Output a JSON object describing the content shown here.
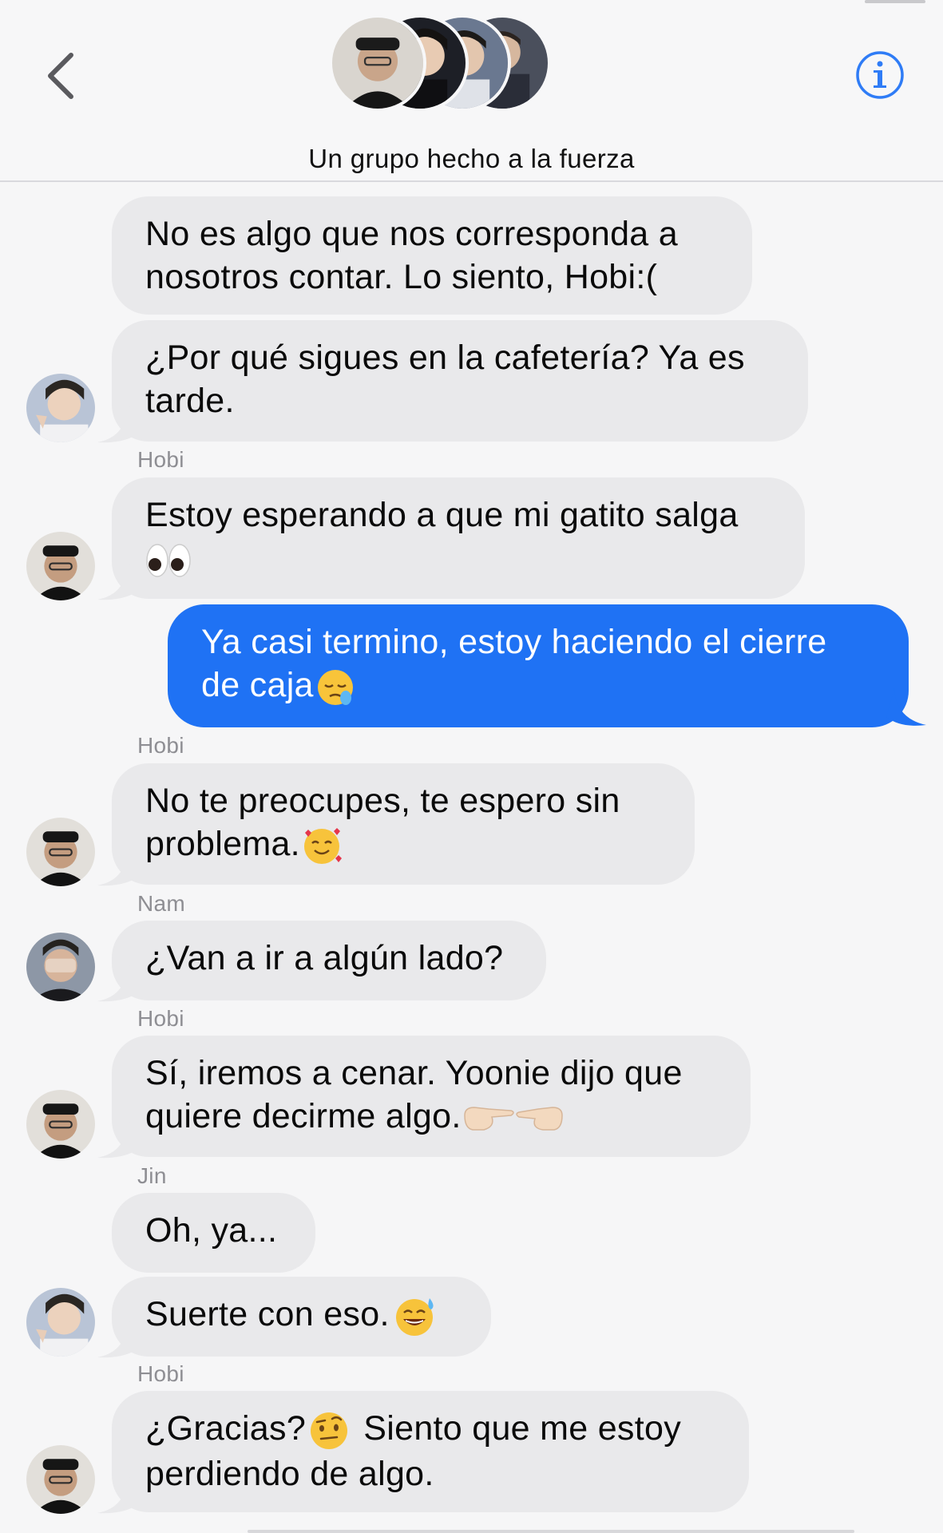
{
  "header": {
    "group_name": "Un grupo hecho a la fuerza",
    "back_icon": "chevron-left-icon",
    "info_icon": "info-icon",
    "accent_color": "#2f7cf6",
    "member_avatars": [
      "avatar-hobi",
      "avatar-jin",
      "avatar-nam",
      "avatar-member-4"
    ]
  },
  "messages": [
    {
      "id": "m1",
      "direction": "incoming",
      "sender": "",
      "text_lines": [
        "No es algo que nos corresponda a",
        "nosotros contar. Lo siento, Hobi:("
      ]
    },
    {
      "id": "m2",
      "direction": "incoming",
      "sender": "",
      "text_lines": [
        "¿Por qué sigues en la cafetería? Ya es",
        "tarde."
      ]
    },
    {
      "id": "m3",
      "direction": "incoming",
      "sender": "Hobi",
      "text_lines": [
        "Estoy esperando a que mi gatito salga",
        ""
      ],
      "emoji": "eyes-emoji"
    },
    {
      "id": "m4",
      "direction": "outgoing",
      "sender": "",
      "text_lines": [
        "Ya casi termino, estoy haciendo el cierre",
        "de caja"
      ],
      "emoji": "sleepy-face-emoji"
    },
    {
      "id": "m5",
      "direction": "incoming",
      "sender": "Hobi",
      "text_lines": [
        "No te preocupes, te espero sin",
        "problema."
      ],
      "emoji": "smiling-face-with-hearts-emoji"
    },
    {
      "id": "m6",
      "direction": "incoming",
      "sender": "Nam",
      "text_lines": [
        "¿Van a ir a algún lado?"
      ]
    },
    {
      "id": "m7",
      "direction": "incoming",
      "sender": "Hobi",
      "text_lines": [
        "Sí, iremos a cenar. Yoonie dijo que",
        "quiere decirme algo."
      ],
      "emoji": "pointing-fingers-emoji"
    },
    {
      "id": "m8",
      "direction": "incoming",
      "sender": "Jin",
      "text_lines": [
        "Oh, ya..."
      ]
    },
    {
      "id": "m9",
      "direction": "incoming",
      "sender": "",
      "text_lines": [
        "Suerte con eso."
      ],
      "emoji": "grinning-sweat-emoji"
    },
    {
      "id": "m10",
      "direction": "incoming",
      "sender": "Hobi",
      "text_lines": [
        "¿Gracias?",
        "perdiendo de algo."
      ],
      "inline_after_emoji": " Siento que me estoy",
      "emoji": "raised-eyebrow-emoji"
    }
  ],
  "colors": {
    "incoming_bubble": "#e9e9eb",
    "outgoing_bubble": "#1f72f4",
    "sender_label": "#8e8e93"
  }
}
